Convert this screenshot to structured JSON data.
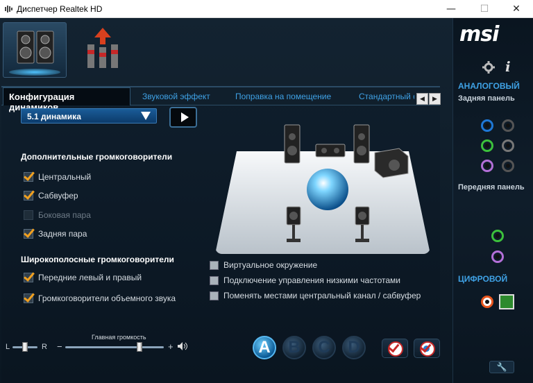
{
  "window": {
    "title": "Диспетчер Realtek HD",
    "minimize": "—",
    "maximize": "☐",
    "close": "✕"
  },
  "tabs": [
    "Конфигурация динамиков",
    "Звуковой эффект",
    "Поправка на помещение",
    "Стандартный ф"
  ],
  "config": {
    "selected": "5.1 динамика",
    "optional_header": "Дополнительные громкоговорители",
    "optional": [
      {
        "label": "Центральный",
        "checked": true,
        "enabled": true
      },
      {
        "label": "Сабвуфер",
        "checked": true,
        "enabled": true
      },
      {
        "label": "Боковая пара",
        "checked": false,
        "enabled": false
      },
      {
        "label": "Задняя пара",
        "checked": true,
        "enabled": true
      }
    ],
    "fullrange_header": "Широкополосные громкоговорители",
    "fullrange": [
      {
        "label": "Передние левый и правый",
        "checked": true
      },
      {
        "label": "Громкоговорители объемного звука",
        "checked": true
      }
    ],
    "options": [
      {
        "label": "Виртуальное окружение",
        "checked": false
      },
      {
        "label": "Подключение управления низкими частотами",
        "checked": false
      },
      {
        "label": "Поменять местами центральный канал / сабвуфер",
        "checked": false
      }
    ]
  },
  "volume": {
    "title": "Главная громкость",
    "left": "L",
    "right": "R",
    "minus": "−",
    "plus": "+",
    "balance": 0.5,
    "level": 0.75
  },
  "presets": [
    "A",
    "B",
    "C",
    "D"
  ],
  "sidebar": {
    "logo": "msi",
    "analog": "АНАЛОГОВЫЙ",
    "rear": "Задняя панель",
    "front": "Передняя панель",
    "digital": "ЦИФРОВОЙ",
    "info_icon": "i"
  },
  "colors": {
    "accent": "#3fa2e6",
    "check": "#f0a020",
    "jack_blue": "#1e78d6",
    "jack_green": "#3cc13c",
    "jack_pink": "#b36fd8",
    "digital_orange": "#e8561e"
  }
}
